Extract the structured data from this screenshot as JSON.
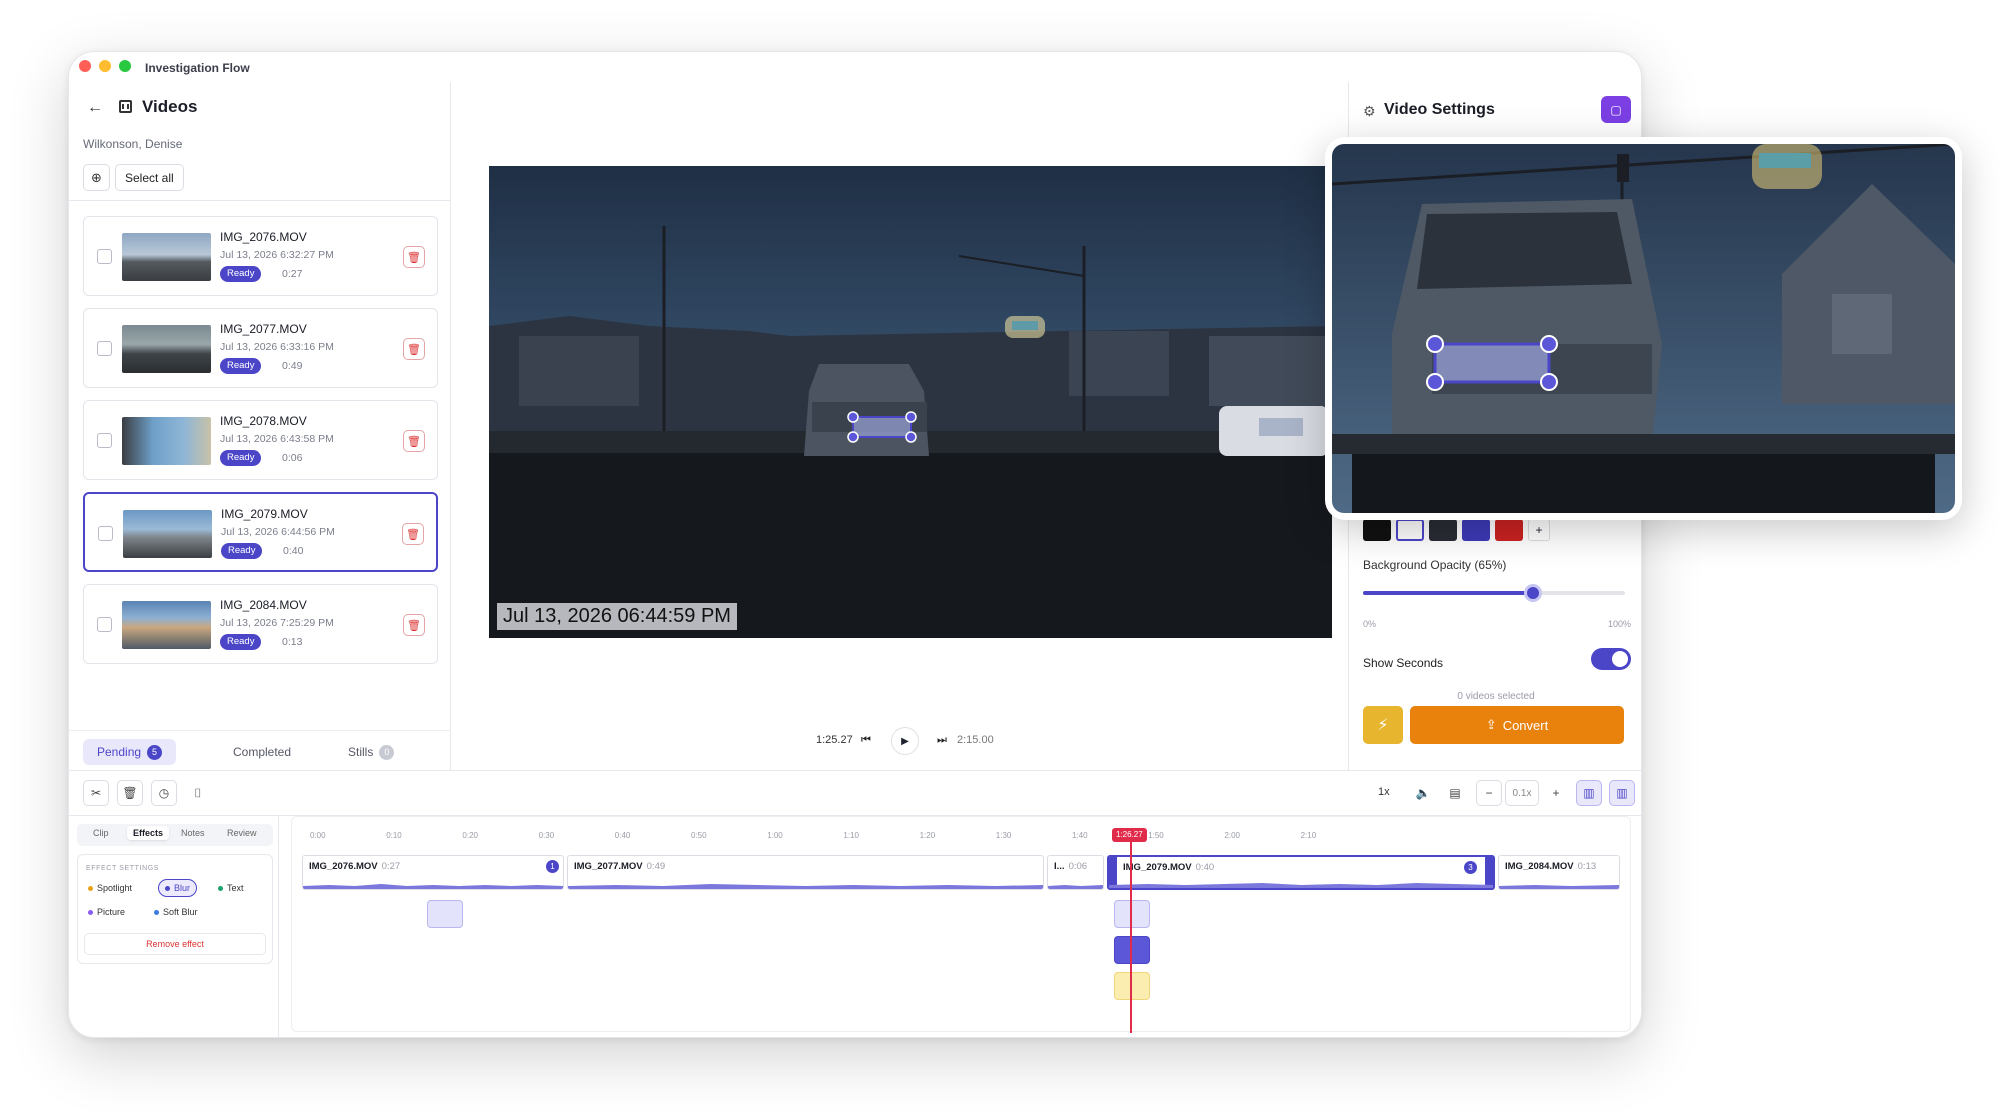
{
  "window": {
    "title": "Investigation Flow"
  },
  "sidebar": {
    "title": "Videos",
    "subtitle": "Wilkonson, Denise",
    "select_all": "Select all",
    "videos": [
      {
        "name": "IMG_2076.MOV",
        "date": "Jul 13, 2026 6:32:27 PM",
        "status": "Ready",
        "duration": "0:27"
      },
      {
        "name": "IMG_2077.MOV",
        "date": "Jul 13, 2026 6:33:16 PM",
        "status": "Ready",
        "duration": "0:49"
      },
      {
        "name": "IMG_2078.MOV",
        "date": "Jul 13, 2026 6:43:58 PM",
        "status": "Ready",
        "duration": "0:06"
      },
      {
        "name": "IMG_2079.MOV",
        "date": "Jul 13, 2026 6:44:56 PM",
        "status": "Ready",
        "duration": "0:40"
      },
      {
        "name": "IMG_2084.MOV",
        "date": "Jul 13, 2026 7:25:29 PM",
        "status": "Ready",
        "duration": "0:13"
      }
    ],
    "tabs": [
      {
        "label": "Pending",
        "count": "5"
      },
      {
        "label": "Completed"
      },
      {
        "label": "Stills",
        "count": "0"
      }
    ]
  },
  "preview": {
    "timestamp": "Jul 13, 2026 06:44:59 PM",
    "current_time": "1:25.27",
    "total_time": "2:15.00"
  },
  "settings": {
    "title": "Video Settings",
    "background_opacity_label": "Background Opacity (65%)",
    "opacity_value": 0.65,
    "slider_min": "0%",
    "slider_max": "100%",
    "show_seconds_label": "Show Seconds",
    "show_seconds": true,
    "selected_text": "0 videos selected",
    "convert_label": "Convert",
    "swatch_colors": [
      "#111111",
      "#ffffff",
      "#2a2c35",
      "#3d3ab8",
      "#cc2222"
    ],
    "add_swatch": "+"
  },
  "toolbar": {
    "speed": "1x",
    "zoom": "0.1x"
  },
  "effects": {
    "tabs": [
      "Clip",
      "Effects",
      "Notes",
      "Review"
    ],
    "active_tab": "Effects",
    "heading": "EFFECT SETTINGS",
    "chips": [
      {
        "label": "Spotlight",
        "color": "#e8a317"
      },
      {
        "label": "Blur",
        "color": "#4b46c8",
        "active": true
      },
      {
        "label": "Text",
        "color": "#1aa36b"
      },
      {
        "label": "Picture",
        "color": "#8a5cf0"
      },
      {
        "label": "Soft Blur",
        "color": "#3a7be0"
      }
    ],
    "remove_label": "Remove effect"
  },
  "timeline": {
    "ticks": [
      "0:00",
      "0:10",
      "0:20",
      "0:30",
      "0:40",
      "0:50",
      "1:00",
      "1:10",
      "1:20",
      "1:30",
      "1:40",
      "1:50",
      "2:00",
      "2:10"
    ],
    "playhead_label": "1:26.27",
    "clips": [
      {
        "name": "IMG_2076.MOV",
        "duration": "0:27",
        "badge": "1"
      },
      {
        "name": "IMG_2077.MOV",
        "duration": "0:49"
      },
      {
        "name": "I...",
        "duration": "0:06"
      },
      {
        "name": "IMG_2079.MOV",
        "duration": "0:40",
        "badge": "3"
      },
      {
        "name": "IMG_2084.MOV",
        "duration": "0:13"
      }
    ]
  },
  "accent": "#4b46c8",
  "convert_color": "#e8820c"
}
